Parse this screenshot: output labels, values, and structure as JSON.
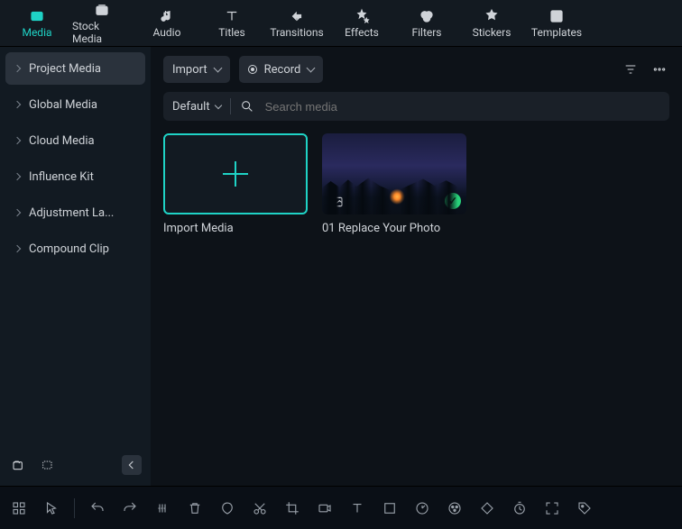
{
  "topnav": [
    {
      "label": "Media",
      "active": true,
      "icon": "media"
    },
    {
      "label": "Stock Media",
      "active": false,
      "icon": "stock"
    },
    {
      "label": "Audio",
      "active": false,
      "icon": "audio"
    },
    {
      "label": "Titles",
      "active": false,
      "icon": "titles"
    },
    {
      "label": "Transitions",
      "active": false,
      "icon": "transitions"
    },
    {
      "label": "Effects",
      "active": false,
      "icon": "effects"
    },
    {
      "label": "Filters",
      "active": false,
      "icon": "filters"
    },
    {
      "label": "Stickers",
      "active": false,
      "icon": "stickers"
    },
    {
      "label": "Templates",
      "active": false,
      "icon": "templates"
    }
  ],
  "sidebar": {
    "items": [
      {
        "label": "Project Media",
        "active": true
      },
      {
        "label": "Global Media",
        "active": false
      },
      {
        "label": "Cloud Media",
        "active": false
      },
      {
        "label": "Influence Kit",
        "active": false
      },
      {
        "label": "Adjustment La...",
        "active": false
      },
      {
        "label": "Compound Clip",
        "active": false
      }
    ]
  },
  "toolbar": {
    "import_label": "Import",
    "record_label": "Record"
  },
  "search": {
    "sort_label": "Default",
    "placeholder": "Search media"
  },
  "tiles": [
    {
      "label": "Import Media",
      "kind": "import"
    },
    {
      "label": "01 Replace Your Photo",
      "kind": "photo"
    }
  ]
}
